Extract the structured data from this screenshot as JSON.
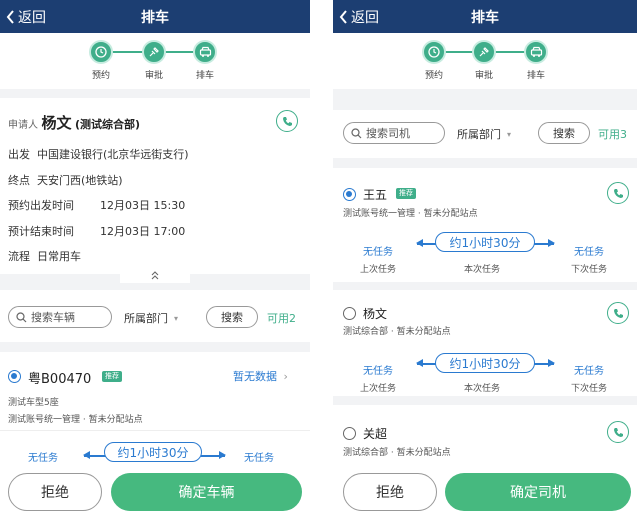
{
  "left": {
    "nav": {
      "back_label": "返回",
      "title": "排车"
    },
    "steps": [
      {
        "label": "预约"
      },
      {
        "label": "审批"
      },
      {
        "label": "排车"
      }
    ],
    "applicant": {
      "prefix": "申请人",
      "name": "杨文",
      "dept": "(测试综合部)",
      "depart_label": "出发",
      "depart_value": "中国建设银行(北京华远街支行)",
      "dest_label": "终点",
      "dest_value": "天安门西(地铁站)",
      "start_label": "预约出发时间",
      "start_value": "12月03日 15:30",
      "end_label": "预计结束时间",
      "end_value": "12月03日 17:00",
      "flow_label": "流程",
      "flow_value": "日常用车"
    },
    "search": {
      "placeholder": "搜索车辆",
      "dept_filter": "所属部门",
      "search_button": "搜索",
      "available": "可用2"
    },
    "vehicle": {
      "plate": "粤B00470",
      "badge": "推荐",
      "no_data": "暂无数据",
      "model": "测试车型5座",
      "owner": "测试账号统一管理 · 暂未分配站点",
      "prev_task": "无任务",
      "duration": "约1小时30分",
      "next_task": "无任务"
    },
    "buttons": {
      "reject": "拒绝",
      "confirm": "确定车辆"
    }
  },
  "right": {
    "nav": {
      "back_label": "返回",
      "title": "排车"
    },
    "steps": [
      {
        "label": "预约"
      },
      {
        "label": "审批"
      },
      {
        "label": "排车"
      }
    ],
    "search": {
      "placeholder": "搜索司机",
      "dept_filter": "所属部门",
      "search_button": "搜索",
      "available": "可用3"
    },
    "drivers": [
      {
        "name": "王五",
        "badge": "推荐",
        "info": "测试账号统一管理 · 暂未分配站点",
        "prev_task": "无任务",
        "prev_label": "上次任务",
        "duration": "约1小时30分",
        "current_label": "本次任务",
        "next_task": "无任务",
        "next_label": "下次任务"
      },
      {
        "name": "杨文",
        "info": "测试综合部 · 暂未分配站点",
        "prev_task": "无任务",
        "prev_label": "上次任务",
        "duration": "约1小时30分",
        "current_label": "本次任务",
        "next_task": "无任务",
        "next_label": "下次任务"
      },
      {
        "name": "关超",
        "info": "测试综合部 · 暂未分配站点"
      }
    ],
    "buttons": {
      "reject": "拒绝",
      "confirm": "确定司机"
    }
  },
  "colors": {
    "navbar": "#1c3e72",
    "accent_green": "#3fae8a",
    "confirm_button": "#46b97f",
    "accent_blue": "#2a7ad0"
  },
  "icons": [
    "back-chevron-icon",
    "clock-icon",
    "approve-icon",
    "car-icon",
    "phone-icon",
    "search-icon",
    "chevron-up-icon",
    "chevron-right-icon",
    "dropdown-icon"
  ]
}
